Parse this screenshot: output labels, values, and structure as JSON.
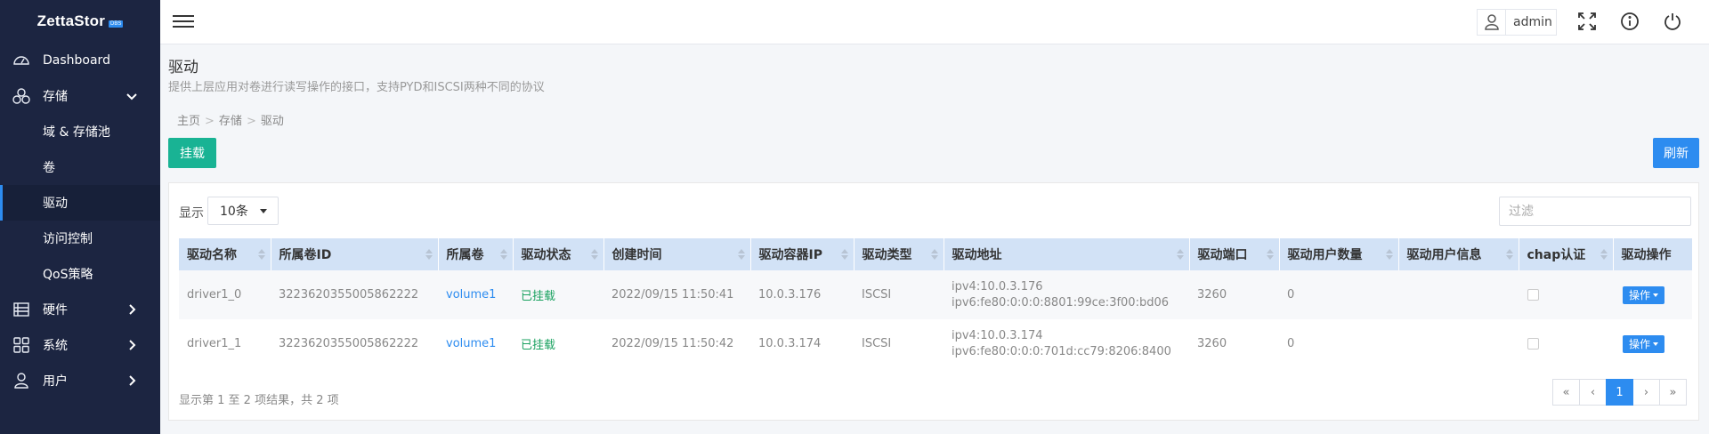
{
  "brand": {
    "name": "ZettaStor",
    "badge": "DBS"
  },
  "sidebar": {
    "items": [
      {
        "label": "Dashboard",
        "icon": "gauge-icon"
      },
      {
        "label": "存储",
        "icon": "storage-cluster-icon",
        "expanded": true,
        "children": [
          {
            "label": "域 & 存储池"
          },
          {
            "label": "卷"
          },
          {
            "label": "驱动",
            "active": true
          },
          {
            "label": "访问控制"
          },
          {
            "label": "QoS策略"
          }
        ]
      },
      {
        "label": "硬件",
        "icon": "hardware-icon"
      },
      {
        "label": "系统",
        "icon": "grid-icon"
      },
      {
        "label": "用户",
        "icon": "user-icon"
      }
    ]
  },
  "topbar": {
    "username": "admin"
  },
  "page": {
    "title": "驱动",
    "description": "提供上层应用对卷进行读写操作的接口，支持PYD和ISCSI两种不同的协议",
    "breadcrumb": [
      "主页",
      "存储",
      "驱动"
    ]
  },
  "actions": {
    "mount": "挂载",
    "refresh": "刷新"
  },
  "table_controls": {
    "show_label": "显示",
    "page_size": "10条",
    "filter_placeholder": "过滤"
  },
  "table": {
    "columns": [
      "驱动名称",
      "所属卷ID",
      "所属卷",
      "驱动状态",
      "创建时间",
      "驱动容器IP",
      "驱动类型",
      "驱动地址",
      "驱动端口",
      "驱动用户数量",
      "驱动用户信息",
      "chap认证",
      "驱动操作"
    ],
    "rows": [
      {
        "name": "driver1_0",
        "volume_id": "3223620355005862222",
        "volume": "volume1",
        "status": "已挂载",
        "created": "2022/09/15 11:50:41",
        "ip": "10.0.3.176",
        "type": "ISCSI",
        "addr_v4": "ipv4:10.0.3.176",
        "addr_v6": "ipv6:fe80:0:0:0:8801:99ce:3f00:bd06",
        "port": "3260",
        "user_count": "0",
        "user_info": "",
        "chap": false,
        "op": "操作"
      },
      {
        "name": "driver1_1",
        "volume_id": "3223620355005862222",
        "volume": "volume1",
        "status": "已挂载",
        "created": "2022/09/15 11:50:42",
        "ip": "10.0.3.174",
        "type": "ISCSI",
        "addr_v4": "ipv4:10.0.3.174",
        "addr_v6": "ipv6:fe80:0:0:0:701d:cc79:8206:8400",
        "port": "3260",
        "user_count": "0",
        "user_info": "",
        "chap": false,
        "op": "操作"
      }
    ],
    "summary": "显示第 1 至 2 项结果，共 2 项"
  },
  "pagination": {
    "first": "«",
    "prev": "‹",
    "current": "1",
    "next": "›",
    "last": "»"
  },
  "colors": {
    "sidebar_bg": "#1c2541",
    "accent_blue": "#2d8cf0",
    "mount_green": "#19b394",
    "header_blue": "#d2e2f6",
    "status_green": "#19a15f"
  }
}
